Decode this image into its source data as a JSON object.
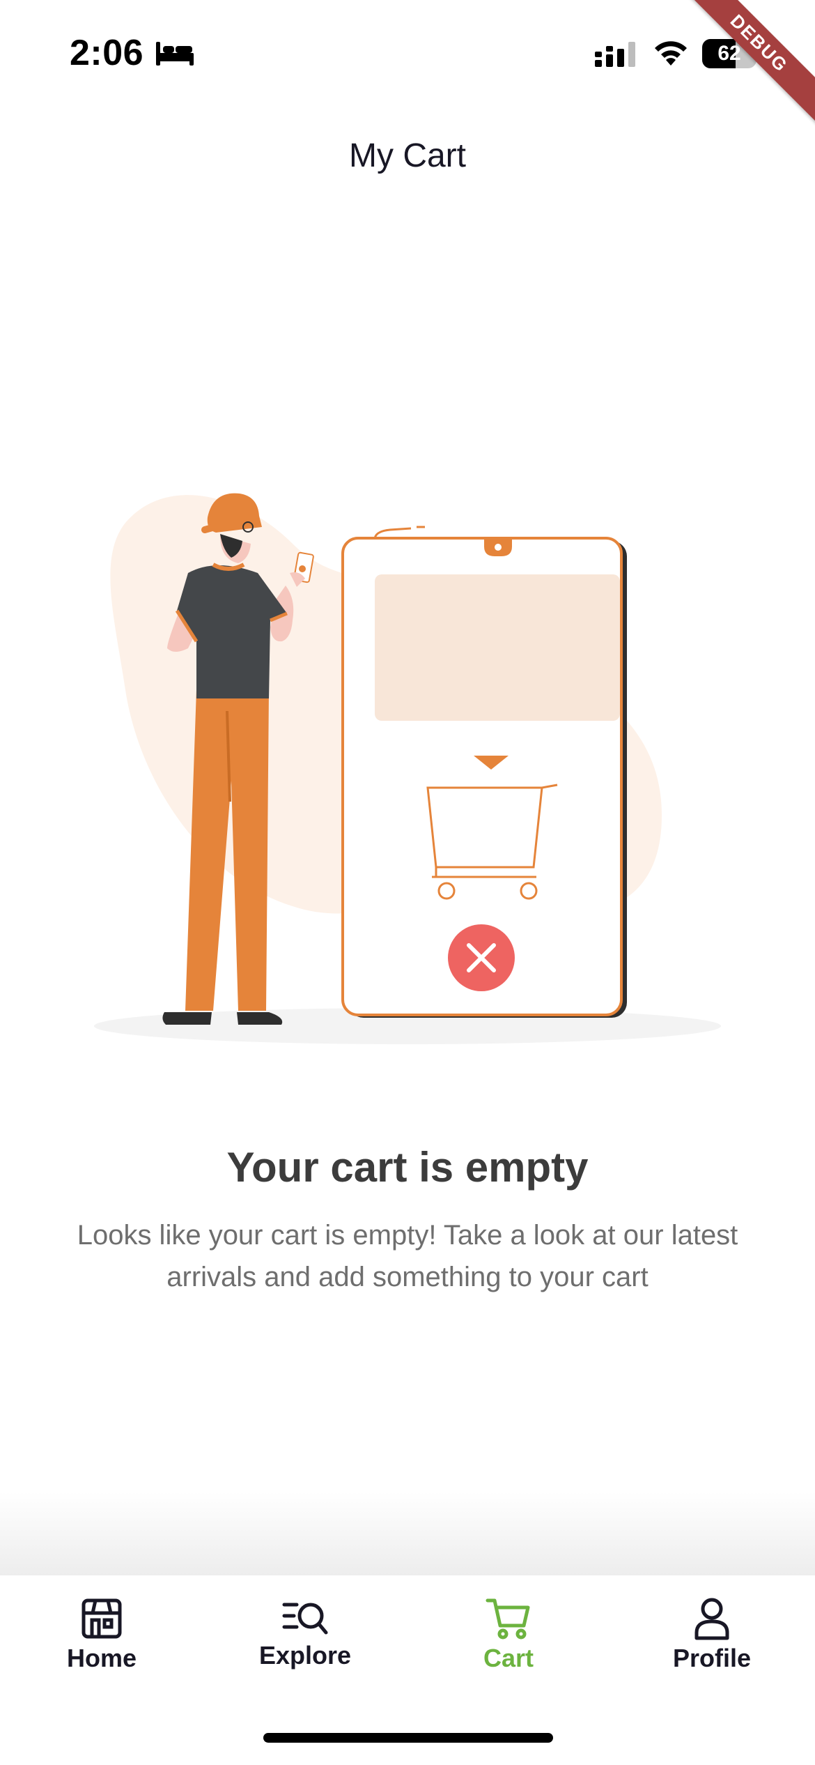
{
  "status_bar": {
    "time": "2:06",
    "battery_level": "62",
    "battery_fraction": 0.62,
    "icons": [
      "bed-icon",
      "cellular-signal-icon",
      "wifi-icon",
      "battery-icon"
    ]
  },
  "debug_banner": "DEBUG",
  "header": {
    "title": "My Cart"
  },
  "empty_state": {
    "illustration": "person-with-phone-empty-cart-illustration",
    "title": "Your cart is empty",
    "description": "Looks like your cart is empty! Take a look at our latest arrivals and add something to your cart"
  },
  "bottom_nav": {
    "items": [
      {
        "label": "Home",
        "icon": "store-icon",
        "active": false
      },
      {
        "label": "Explore",
        "icon": "search-list-icon",
        "active": false
      },
      {
        "label": "Cart",
        "icon": "cart-icon",
        "active": true
      },
      {
        "label": "Profile",
        "icon": "user-icon",
        "active": false
      }
    ]
  },
  "colors": {
    "accent": "#6cb33f",
    "illustration_orange": "#e5843a",
    "illustration_peach": "#f8e6d8",
    "error_red": "#ee6461",
    "debug_ribbon": "#a5403f",
    "title_text": "#3c3c3c",
    "body_text": "#6e6e6e"
  }
}
